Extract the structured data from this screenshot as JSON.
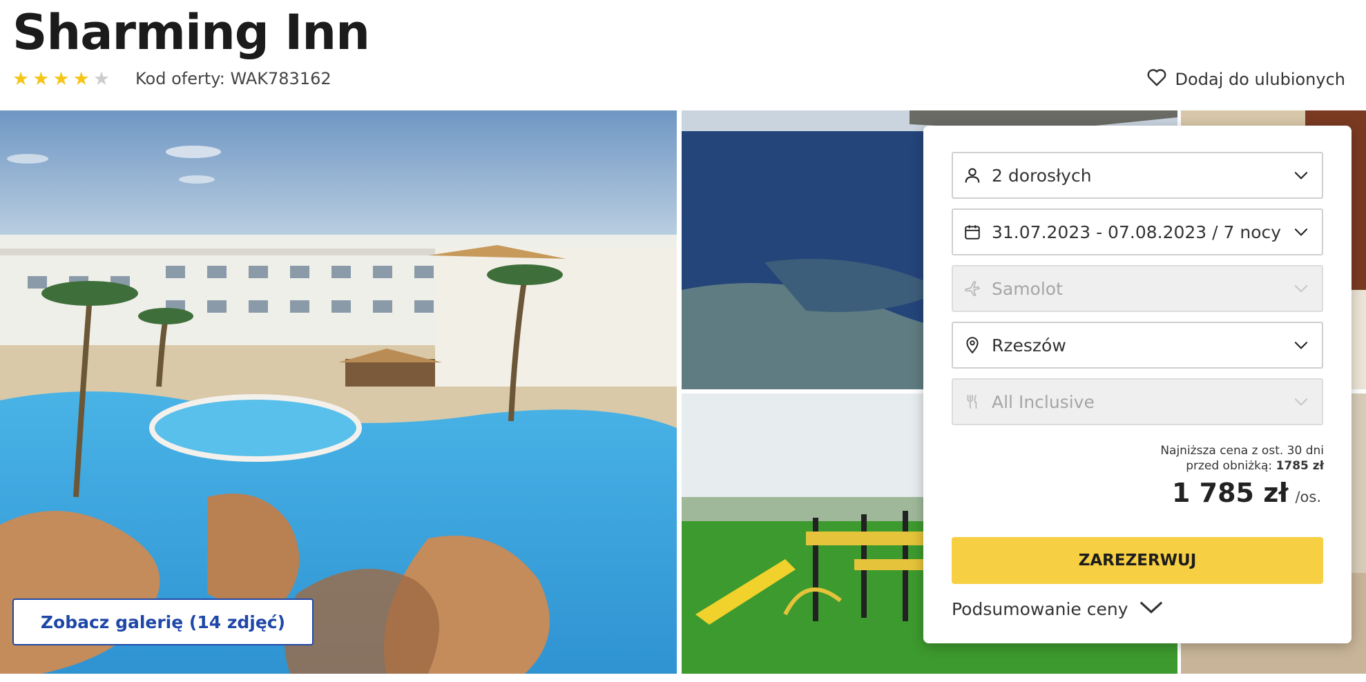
{
  "hotel": {
    "name": "Sharming Inn",
    "rating": 4,
    "max_rating": 5,
    "offer_code": "Kod oferty: WAK783162",
    "favorite_label": "Dodaj do ulubionych"
  },
  "gallery": {
    "button_label": "Zobacz galerię (14 zdjęć)"
  },
  "booking": {
    "fields": [
      {
        "label": "2 dorosłych",
        "icon": "person-icon",
        "disabled": false
      },
      {
        "label": "31.07.2023 - 07.08.2023 / 7 nocy",
        "icon": "calendar-icon",
        "disabled": false
      },
      {
        "label": "Samolot",
        "icon": "plane-icon",
        "disabled": true
      },
      {
        "label": "Rzeszów",
        "icon": "location-pin-icon",
        "disabled": false
      },
      {
        "label": "All Inclusive",
        "icon": "cutlery-icon",
        "disabled": true
      }
    ],
    "lowest_price_line1": "Najniższa cena z ost. 30 dni",
    "lowest_price_line2": "przed obniżką:",
    "lowest_price_value": "1785 zł",
    "price": "1 785 zł",
    "price_unit": "/os.",
    "reserve_label": "ZAREZERWUJ",
    "summary_label": "Podsumowanie ceny"
  },
  "colors": {
    "accent_yellow": "#f7cf42",
    "star_active": "#f5c518",
    "star_inactive": "#cccccc",
    "link_blue": "#1f47a8"
  }
}
